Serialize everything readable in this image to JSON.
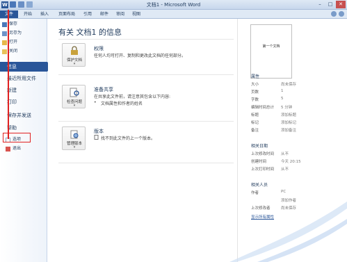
{
  "window": {
    "title": "文档1 - Microsoft Word",
    "app_icon": "W"
  },
  "tabs": [
    "文件",
    "开始",
    "插入",
    "页面布局",
    "引用",
    "邮件",
    "审阅",
    "视图"
  ],
  "backstage_commands": [
    "保存",
    "另存为",
    "打开",
    "关闭"
  ],
  "nav_items": [
    "信息",
    "最近所用文件",
    "新建",
    "打印",
    "保存并发送",
    "帮助"
  ],
  "option_items": [
    "选项",
    "退出"
  ],
  "main": {
    "heading": "有关 文档1 的信息",
    "sections": [
      {
        "button_label": "保护文档",
        "title": "权限",
        "lines": [
          "任何人均可打开、复制和更改此文档的任何部分。"
        ]
      },
      {
        "button_label": "检查问题",
        "title": "准备共享",
        "lines": [
          "在共享此文件前，请注意其包含以下内容:",
          "文档属性和作者的姓名"
        ]
      },
      {
        "button_label": "管理版本",
        "title": "版本",
        "lines": [
          "找不到此文件的上一个版本。"
        ]
      }
    ]
  },
  "preview": {
    "text": "第一个文档"
  },
  "properties": {
    "header": "属性",
    "rows": [
      {
        "label": "大小",
        "value": "尚未保存"
      },
      {
        "label": "页数",
        "value": "1"
      },
      {
        "label": "字数",
        "value": "5"
      },
      {
        "label": "编辑时间总计",
        "value": "5 分钟"
      },
      {
        "label": "标题",
        "value": "添加标题"
      },
      {
        "label": "标记",
        "value": "添加标记"
      },
      {
        "label": "备注",
        "value": "添加备注"
      }
    ]
  },
  "dates": {
    "header": "相关日期",
    "rows": [
      {
        "label": "上次修改时间",
        "value": "从不"
      },
      {
        "label": "创建时间",
        "value": "今天 20:15"
      },
      {
        "label": "上次打印时间",
        "value": "从不"
      }
    ]
  },
  "people": {
    "header": "相关人员",
    "rows": [
      {
        "label": "作者",
        "value": "PC"
      },
      {
        "label": "",
        "value": "添加作者"
      },
      {
        "label": "上次修改者",
        "value": "尚未保存"
      }
    ],
    "link": "显示所有属性"
  },
  "colors": {
    "accent": "#2a5699",
    "annotation": "#e02020"
  }
}
